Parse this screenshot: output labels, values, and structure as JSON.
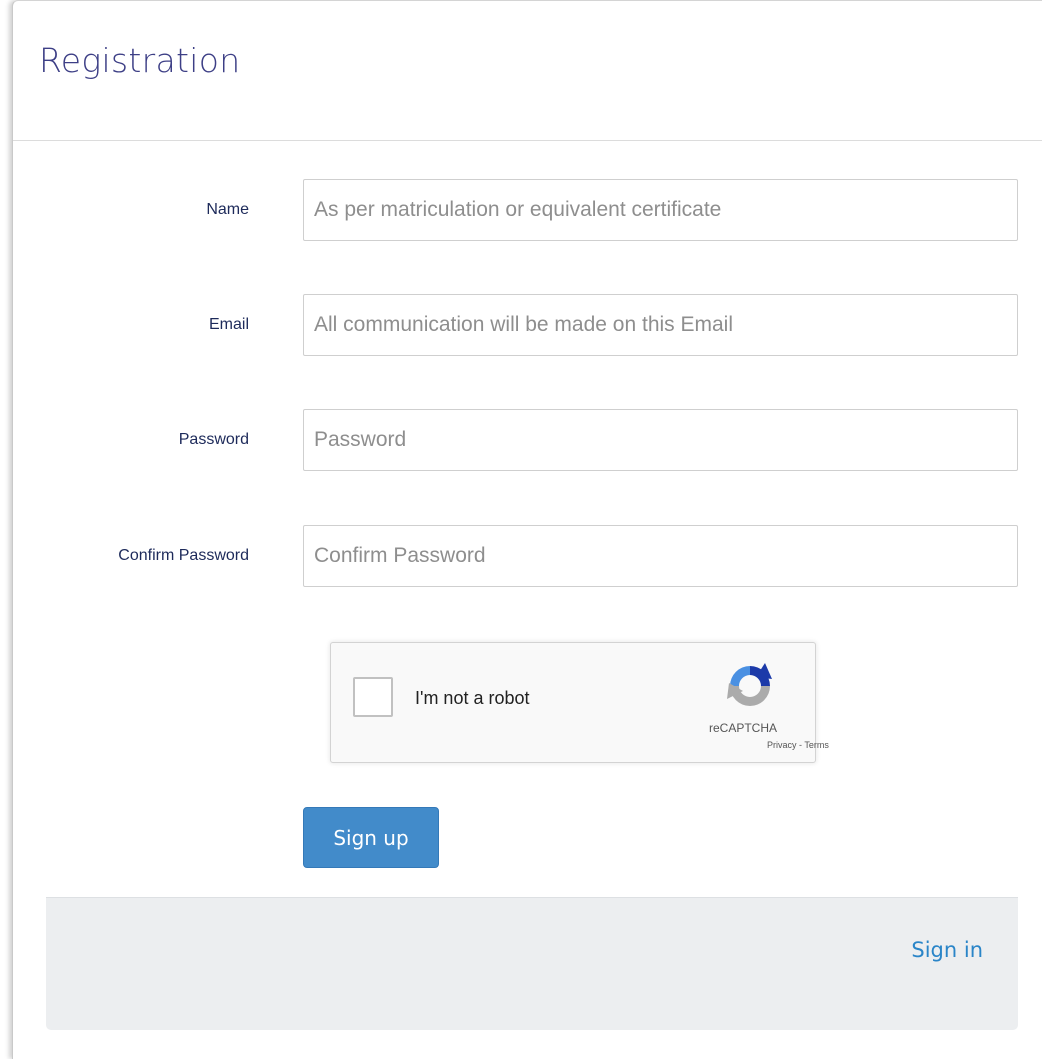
{
  "header": {
    "title": "Registration"
  },
  "form": {
    "fields": [
      {
        "label": "Name",
        "placeholder": "As per matriculation or equivalent certificate",
        "value": ""
      },
      {
        "label": "Email",
        "placeholder": "All communication will be made on this Email",
        "value": ""
      },
      {
        "label": "Password",
        "placeholder": "Password",
        "value": ""
      },
      {
        "label": "Confirm Password",
        "placeholder": "Confirm Password",
        "value": ""
      }
    ],
    "submit_label": "Sign up"
  },
  "captcha": {
    "label": "I'm not a robot",
    "brand": "reCAPTCHA",
    "privacy": "Privacy",
    "separator": " - ",
    "terms": "Terms",
    "checked": false,
    "icon": "recaptcha-logo-icon",
    "colors": {
      "blue": "#1c3aa9",
      "lightblue": "#4a90e2",
      "gray": "#ababab"
    }
  },
  "footer": {
    "signin_label": "Sign in"
  },
  "colors": {
    "title": "#3d3f86",
    "label": "#1d2a5a",
    "button": "#428bca",
    "link": "#2a85c8",
    "footer_bg": "#eceef0"
  }
}
